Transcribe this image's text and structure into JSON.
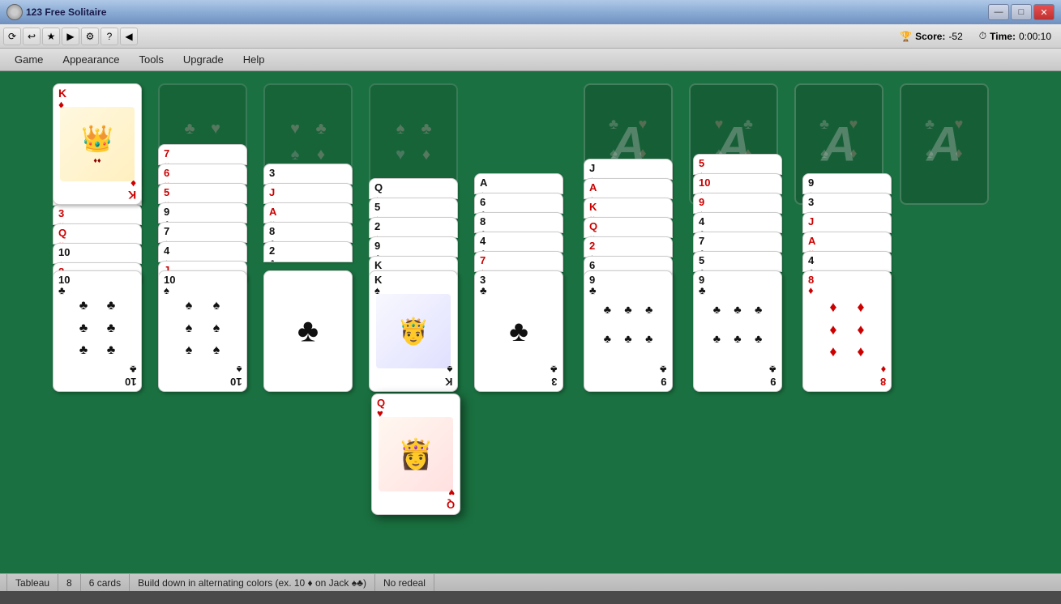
{
  "window": {
    "title": "123 Free Solitaire",
    "controls": {
      "minimize": "—",
      "maximize": "□",
      "close": "✕"
    }
  },
  "toolbar": {
    "icons": [
      "⟳",
      "↩",
      "★",
      "▶",
      "⚙",
      "?",
      "◀"
    ]
  },
  "menubar": {
    "items": [
      "Game",
      "Appearance",
      "Tools",
      "Upgrade",
      "Help"
    ]
  },
  "scorebar": {
    "score_label": "Score:",
    "score_value": "-52",
    "time_label": "Time:",
    "time_value": "0:00:10"
  },
  "statusbar": {
    "game_type": "Tableau",
    "columns": "8",
    "cards": "6 cards",
    "rule": "Build down in alternating colors (ex. 10 ♦ on Jack ♠♣)",
    "redeal": "No redeal"
  }
}
